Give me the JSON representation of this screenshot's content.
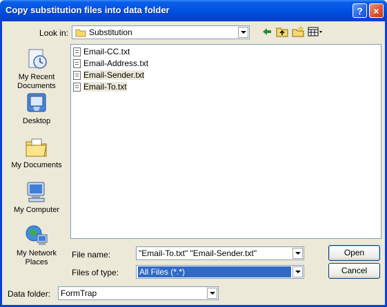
{
  "window": {
    "title": "Copy substitution files into data folder",
    "help_glyph": "?",
    "close_glyph": "×"
  },
  "lookin": {
    "label": "Look in:",
    "value": "Substitution"
  },
  "places": [
    {
      "label": "My Recent Documents",
      "icon": "recent-documents-icon"
    },
    {
      "label": "Desktop",
      "icon": "desktop-icon"
    },
    {
      "label": "My Documents",
      "icon": "my-documents-icon"
    },
    {
      "label": "My Computer",
      "icon": "my-computer-icon"
    },
    {
      "label": "My Network Places",
      "icon": "network-places-icon"
    }
  ],
  "files": [
    {
      "name": "Email-CC.txt",
      "selected": false
    },
    {
      "name": "Email-Address.txt",
      "selected": false
    },
    {
      "name": "Email-Sender.txt",
      "selected": true
    },
    {
      "name": "Email-To.txt",
      "selected": true
    }
  ],
  "filename": {
    "label": "File name:",
    "value": "\"Email-To.txt\" \"Email-Sender.txt\""
  },
  "filetype": {
    "label": "Files of type:",
    "value": "All Files (*.*)"
  },
  "datafolder": {
    "label": "Data folder:",
    "value": "FormTrap"
  },
  "buttons": {
    "open": "Open",
    "cancel": "Cancel"
  },
  "colors": {
    "titlebar": "#0054e3",
    "dialog_bg": "#ece9d8",
    "selection": "#316ac5"
  }
}
